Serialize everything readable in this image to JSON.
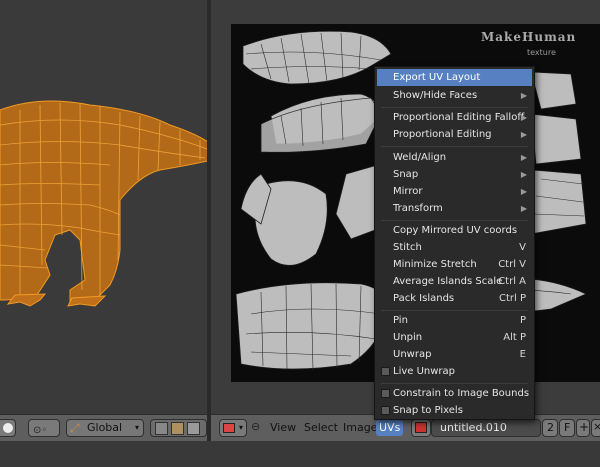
{
  "viewport_header": {
    "orientation": "Global"
  },
  "uv_header": {
    "menus": [
      "View",
      "Select",
      "Image",
      "UVs"
    ],
    "active_menu": "UVs",
    "image_name": "untitled.010",
    "users_count": "2",
    "fake_user": "F"
  },
  "uv_image": {
    "watermark_title": "MakeHuman",
    "watermark_sub": "texture"
  },
  "uvs_menu": {
    "items": [
      {
        "label": "Export UV Layout",
        "shortcut": "",
        "submenu": false,
        "checkbox": false
      },
      {
        "label": "Show/Hide Faces",
        "shortcut": "",
        "submenu": true,
        "checkbox": false
      },
      {
        "label": "Proportional Editing Falloff",
        "shortcut": "",
        "submenu": true,
        "checkbox": false
      },
      {
        "label": "Proportional Editing",
        "shortcut": "",
        "submenu": true,
        "checkbox": false
      },
      {
        "label": "Weld/Align",
        "shortcut": "",
        "submenu": true,
        "checkbox": false
      },
      {
        "label": "Snap",
        "shortcut": "",
        "submenu": true,
        "checkbox": false
      },
      {
        "label": "Mirror",
        "shortcut": "",
        "submenu": true,
        "checkbox": false
      },
      {
        "label": "Transform",
        "shortcut": "",
        "submenu": true,
        "checkbox": false
      },
      {
        "label": "Copy Mirrored UV coords",
        "shortcut": "",
        "submenu": false,
        "checkbox": false
      },
      {
        "label": "Stitch",
        "shortcut": "V",
        "submenu": false,
        "checkbox": false
      },
      {
        "label": "Minimize Stretch",
        "shortcut": "Ctrl V",
        "submenu": false,
        "checkbox": false
      },
      {
        "label": "Average Islands Scale",
        "shortcut": "Ctrl A",
        "submenu": false,
        "checkbox": false
      },
      {
        "label": "Pack Islands",
        "shortcut": "Ctrl P",
        "submenu": false,
        "checkbox": false
      },
      {
        "label": "Pin",
        "shortcut": "P",
        "submenu": false,
        "checkbox": false
      },
      {
        "label": "Unpin",
        "shortcut": "Alt P",
        "submenu": false,
        "checkbox": false
      },
      {
        "label": "Unwrap",
        "shortcut": "E",
        "submenu": false,
        "checkbox": false
      },
      {
        "label": "Live Unwrap",
        "shortcut": "",
        "submenu": false,
        "checkbox": true
      },
      {
        "label": "Constrain to Image Bounds",
        "shortcut": "",
        "submenu": false,
        "checkbox": true
      },
      {
        "label": "Snap to Pixels",
        "shortcut": "",
        "submenu": false,
        "checkbox": true
      }
    ],
    "highlighted": "Export UV Layout"
  },
  "colors": {
    "accent": "#5680c2",
    "wire": "#f0901c",
    "mesh": "#c8c8c8"
  }
}
